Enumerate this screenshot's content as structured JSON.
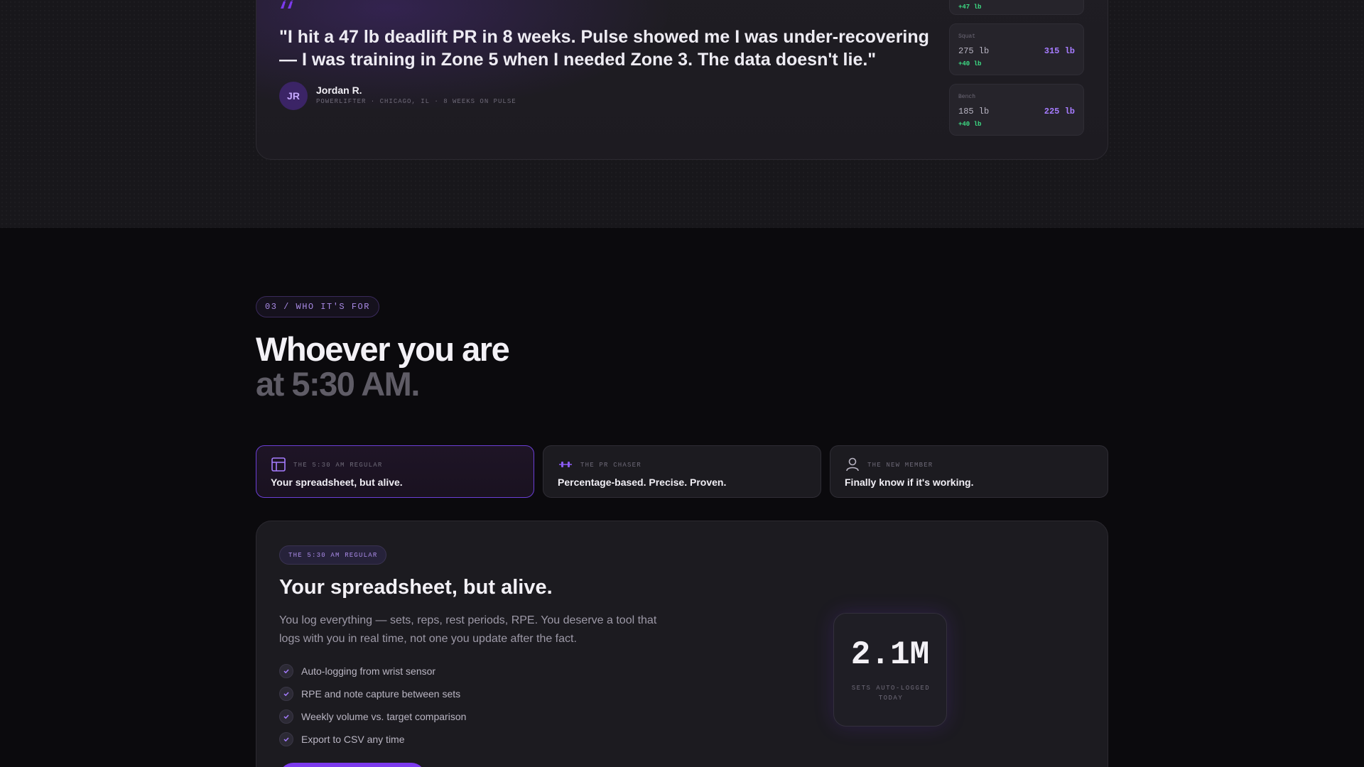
{
  "testimonial": {
    "quote": "\"I hit a 47 lb deadlift PR in 8 weeks. Pulse showed me I was under-recovering — I was training in Zone 5 when I needed Zone 3. The data doesn't lie.\"",
    "author_initials": "JR",
    "author_name": "Jordan R.",
    "author_meta": "POWERLIFTER · CHICAGO, IL · 8 WEEKS ON PULSE",
    "lifts": [
      {
        "name": "Squat",
        "from": "275 lb",
        "to": "315 lb",
        "delta": "+40 lb"
      },
      {
        "name": "Bench",
        "from": "185 lb",
        "to": "225 lb",
        "delta": "+40 lb"
      }
    ],
    "partial_lift_delta": "+47 lb"
  },
  "section": {
    "tag": "03 / WHO IT'S FOR",
    "headline_line1": "Whoever you are",
    "headline_line2": "at 5:30 AM."
  },
  "tabs": [
    {
      "label": "THE 5:30 AM REGULAR",
      "title": "Your spreadsheet, but alive.",
      "icon": "layout-icon",
      "active": true
    },
    {
      "label": "THE PR CHASER",
      "title": "Percentage-based. Precise. Proven.",
      "icon": "dumbbell-icon",
      "active": false
    },
    {
      "label": "THE NEW MEMBER",
      "title": "Finally know if it's working.",
      "icon": "user-icon",
      "active": false
    }
  ],
  "detail": {
    "tag": "THE 5:30 AM REGULAR",
    "title": "Your spreadsheet, but alive.",
    "description": "You log everything — sets, reps, rest periods, RPE. You deserve a tool that logs with you in real time, not one you update after the fact.",
    "features": [
      "Auto-logging from wrist sensor",
      "RPE and note capture between sets",
      "Weekly volume vs. target comparison",
      "Export to CSV any time"
    ],
    "stat_value": "2.1M",
    "stat_label": "SETS AUTO-LOGGED TODAY"
  },
  "colors": {
    "accent": "#7c3aed",
    "accent_light": "#a67cff",
    "positive": "#3ddc84",
    "background": "#0b0a0d",
    "card": "#1c1b20"
  }
}
